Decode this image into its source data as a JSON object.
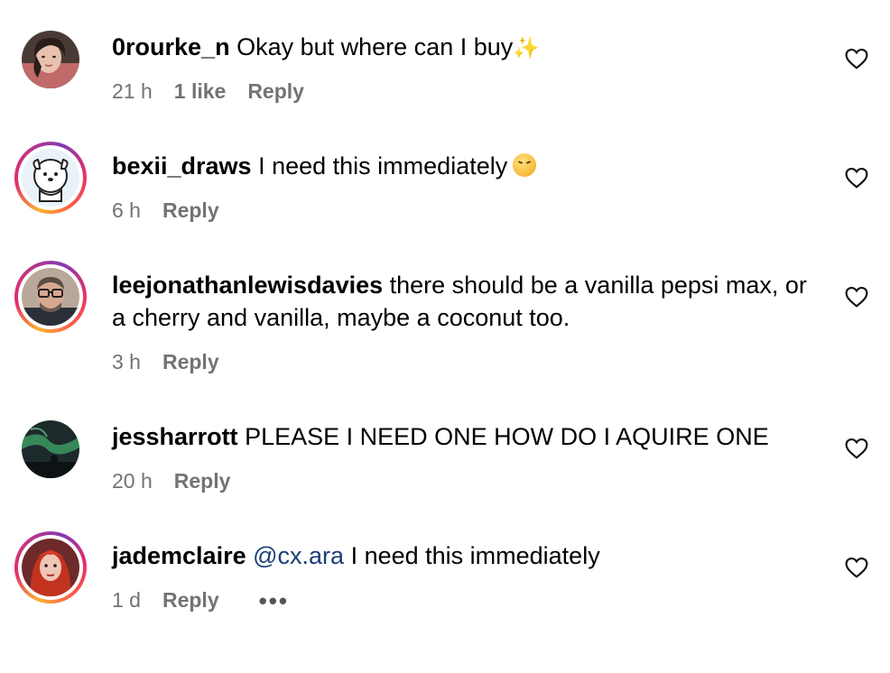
{
  "comments": [
    {
      "username": "0rourke_n",
      "text": "Okay but where can I buy",
      "emoji": "✨",
      "time": "21 h",
      "likes": "1 like",
      "reply": "Reply",
      "avatar": "woman-portrait-photo",
      "story_ring": false
    },
    {
      "username": "bexii_draws",
      "text": "I need this immediately",
      "emoji": "steam-from-nose-face",
      "time": "6 h",
      "reply": "Reply",
      "avatar": "cartoon-dog-illustration",
      "story_ring": true
    },
    {
      "username": "leejonathanlewisdavies",
      "text": "there should be a vanilla pepsi max, or a cherry and vanilla, maybe a coconut too.",
      "time": "3 h",
      "reply": "Reply",
      "avatar": "man-with-glasses-photo",
      "story_ring": true
    },
    {
      "username": "jessharrott",
      "text": "PLEASE I NEED ONE HOW DO I AQUIRE ONE",
      "time": "20 h",
      "reply": "Reply",
      "avatar": "northern-lights-photo",
      "story_ring": false
    },
    {
      "username": "jademclaire",
      "mention": "@cx.ara",
      "text": "I need this immediately",
      "time": "1 d",
      "reply": "Reply",
      "more": "•••",
      "avatar": "red-hair-woman-photo",
      "story_ring": true
    }
  ],
  "icons": {
    "like": "heart-outline-icon",
    "more": "more-options-icon"
  },
  "colors": {
    "meta": "#737373",
    "mention": "#1a3e7a",
    "ring_start": "#f9b233",
    "ring_end": "#c13584"
  }
}
